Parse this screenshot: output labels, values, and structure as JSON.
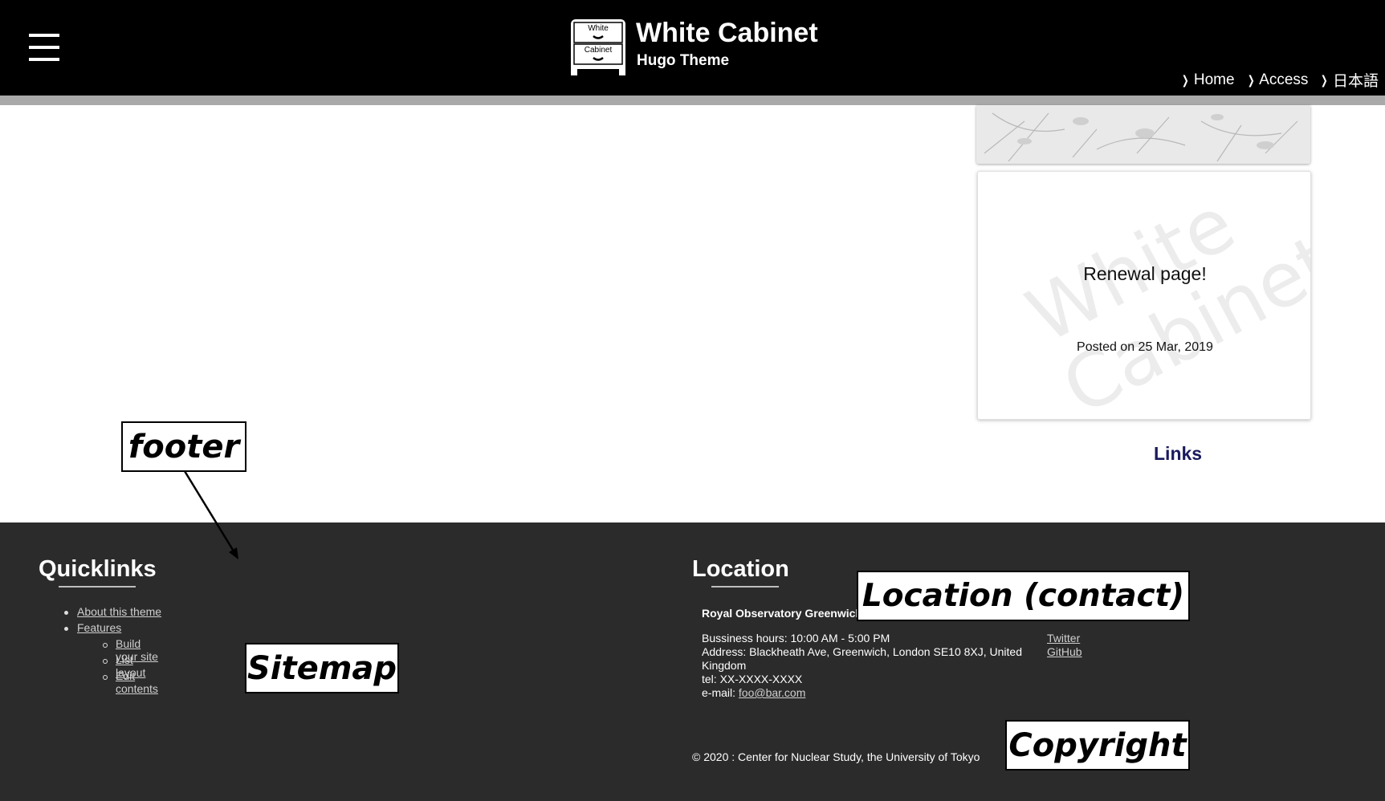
{
  "header": {
    "menu_icon": "hamburger-icon",
    "logo_top": "White",
    "logo_bottom": "Cabinet",
    "title": "White Cabinet",
    "subtitle": "Hugo Theme",
    "nav": [
      {
        "label": "Home",
        "icon": "chevron-right-icon"
      },
      {
        "label": "Access",
        "icon": "chevron-right-icon"
      },
      {
        "label": "日本語",
        "icon": "chevron-right-icon"
      }
    ]
  },
  "sidebar": {
    "post_card": {
      "watermark_line1": "White",
      "watermark_line2": "Cabinet",
      "title": "Renewal page!",
      "date": "Posted on 25 Mar, 2019"
    },
    "links_heading": "Links"
  },
  "footer": {
    "quicklinks": {
      "heading": "Quicklinks",
      "items": [
        {
          "label": "About this theme"
        },
        {
          "label": "Features",
          "children": [
            {
              "label": "Build your site"
            },
            {
              "label": "List layout"
            },
            {
              "label": "Edit contents"
            }
          ]
        }
      ]
    },
    "location": {
      "heading": "Location",
      "name": "Royal Observatory Greenwich",
      "hours": "Bussiness hours: 10:00 AM - 5:00 PM",
      "address": "Address: Blackheath Ave, Greenwich, London SE10 8XJ, United Kingdom",
      "tel": "tel: XX-XXXX-XXXX",
      "email_label": "e-mail: ",
      "email": "foo@bar.com",
      "social": [
        "Twitter",
        "GitHub"
      ]
    },
    "copyright": "© 2020 : Center for Nuclear Study, the University of Tokyo"
  },
  "annotations": {
    "footer": "footer",
    "location": "Location (contact)",
    "sitemap": "Sitemap",
    "copyright": "Copyright"
  },
  "colors": {
    "header_bg": "#000000",
    "band": "#a9a9a9",
    "footer_bg": "#2b2b2b",
    "links_heading": "#1a1a5e"
  }
}
